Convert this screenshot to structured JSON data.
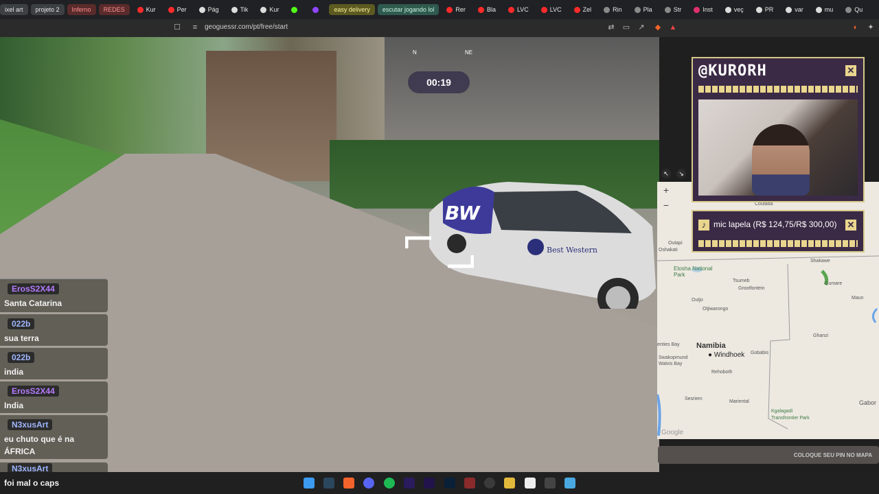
{
  "bookmarks": [
    {
      "label": "ixel art",
      "style": "pill",
      "icon": "folder-icon"
    },
    {
      "label": "projeto 2",
      "style": "pill",
      "icon": "folder-icon"
    },
    {
      "label": "Inferno",
      "style": "red",
      "icon": "folder-icon"
    },
    {
      "label": "REDES",
      "style": "red",
      "icon": "folder-icon"
    },
    {
      "label": "Kur",
      "style": "plain",
      "icon": "youtube-icon"
    },
    {
      "label": "Per",
      "style": "plain",
      "icon": "youtube-icon"
    },
    {
      "label": "Pág",
      "style": "plain",
      "icon": "x-icon"
    },
    {
      "label": "Tik",
      "style": "plain",
      "icon": "tiktok-icon"
    },
    {
      "label": "Kur",
      "style": "plain",
      "icon": "tiktok-icon"
    },
    {
      "label": "",
      "style": "plain",
      "icon": "kick-icon"
    },
    {
      "label": "",
      "style": "plain",
      "icon": "twitch-icon"
    },
    {
      "label": "easy delivery",
      "style": "olive",
      "icon": "folder-icon"
    },
    {
      "label": "escutar jogando lol",
      "style": "teal",
      "icon": "folder-icon"
    },
    {
      "label": "Rer",
      "style": "plain",
      "icon": "youtube-icon"
    },
    {
      "label": "Bla",
      "style": "plain",
      "icon": "youtube-icon"
    },
    {
      "label": "LVC",
      "style": "plain",
      "icon": "youtube-icon"
    },
    {
      "label": "LVC",
      "style": "plain",
      "icon": "youtube-icon"
    },
    {
      "label": "Zel",
      "style": "plain",
      "icon": "youtube-icon"
    },
    {
      "label": "Rin",
      "style": "plain",
      "icon": "link-icon"
    },
    {
      "label": "Pla",
      "style": "plain",
      "icon": "link-icon"
    },
    {
      "label": "Str",
      "style": "plain",
      "icon": "link-icon"
    },
    {
      "label": "Inst",
      "style": "plain",
      "icon": "instagram-icon"
    },
    {
      "label": "veç",
      "style": "plain",
      "icon": "google-icon"
    },
    {
      "label": "PR",
      "style": "plain",
      "icon": "google-icon"
    },
    {
      "label": "var",
      "style": "plain",
      "icon": "google-icon"
    },
    {
      "label": "mu",
      "style": "plain",
      "icon": "google-icon"
    },
    {
      "label": "Qu",
      "style": "plain",
      "icon": "link-icon"
    }
  ],
  "address_bar": {
    "url": "geoguessr.com/pt/free/start"
  },
  "street_view": {
    "timer": "00:19",
    "compass": {
      "n": "N",
      "ne": "NE"
    },
    "car_logo": "BW",
    "car_text": "Best Western"
  },
  "chat": [
    {
      "user": "ErosS2X44",
      "text": "Santa Catarina"
    },
    {
      "user": "022b",
      "text": "sua terra"
    },
    {
      "user": "022b",
      "text": "india"
    },
    {
      "user": "ErosS2X44",
      "text": "India"
    },
    {
      "user": "N3xusArt",
      "text": "eu chuto que é na ÁFRICA"
    },
    {
      "user": "N3xusArt",
      "text": "foi mal o caps"
    }
  ],
  "overlay": {
    "channel": "@KURORH",
    "now_playing": "mic lapela (R$ 124,75/R$ 300,00)"
  },
  "map": {
    "labels": {
      "namibia": "Namibia",
      "windhoek": "Windhoek",
      "etosha": "Etosha National Park",
      "outapi": "Outapi",
      "oshakati": "Oshakati",
      "tsumeb": "Tsumeb",
      "grootfontein": "Grootfontein",
      "outjo": "Outjo",
      "otjiwarongo": "Otjiwarongo",
      "bay": "enties Bay",
      "swakopmund": "Swakopmund",
      "walvis": "Walvis Bay",
      "gobabis": "Gobabis",
      "rehoboth": "Rehoboth",
      "sesriem": "Sesriem",
      "mariental": "Mariental",
      "kgalagadi": "Kgalagadi Transfrontier Park",
      "shakawe": "Shakawe",
      "gumare": "Gumare",
      "maun": "Maun",
      "ghanzi": "Ghanzi",
      "gaborone": "Gabor",
      "coutada": "Coutada",
      "google": "Google"
    },
    "guess_button": "COLOQUE SEU PIN NO MAPA"
  }
}
